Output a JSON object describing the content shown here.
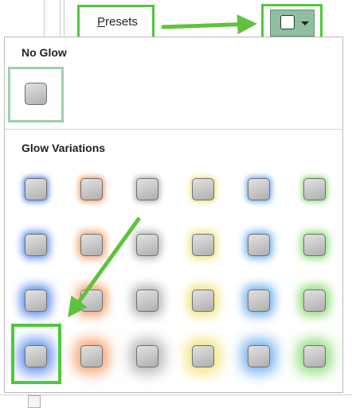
{
  "toolbar": {
    "presets_label_mnemonic": "P",
    "presets_label_rest": "resets"
  },
  "gallery": {
    "no_glow_heading": "No Glow",
    "glow_variations_heading": "Glow Variations",
    "glow_colors": [
      "#5b8cf0",
      "#f3a06c",
      "#b4b4b4",
      "#f3e37a",
      "#6faef0",
      "#8fdc77"
    ],
    "glow_levels": [
      "small",
      "medium",
      "large",
      "extra-large"
    ],
    "selected": {
      "row": 4,
      "column": 1
    }
  },
  "annotations": {
    "highlight_color": "#4fc83a"
  }
}
